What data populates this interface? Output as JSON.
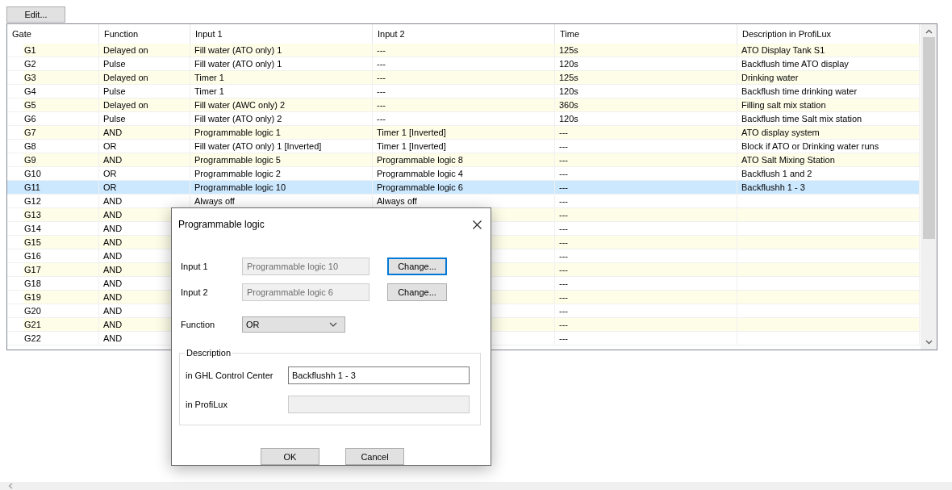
{
  "toolbar": {
    "edit_button": "Edit..."
  },
  "table": {
    "columns": [
      "Gate",
      "Function",
      "Input 1",
      "Input 2",
      "Time",
      "Description in ProfiLux"
    ],
    "rows": [
      {
        "gate": "G1",
        "function": "Delayed on",
        "input_1": "Fill water (ATO only) 1",
        "input_2": "---",
        "time": "125s",
        "description": "ATO Display Tank S1",
        "selected": false
      },
      {
        "gate": "G2",
        "function": "Pulse",
        "input_1": "Fill water (ATO only) 1",
        "input_2": "---",
        "time": "120s",
        "description": "Backflush time ATO display",
        "selected": false
      },
      {
        "gate": "G3",
        "function": "Delayed on",
        "input_1": "Timer 1",
        "input_2": "---",
        "time": "125s",
        "description": "Drinking water",
        "selected": false
      },
      {
        "gate": "G4",
        "function": "Pulse",
        "input_1": "Timer 1",
        "input_2": "---",
        "time": "120s",
        "description": "Backflush time drinking water",
        "selected": false
      },
      {
        "gate": "G5",
        "function": "Delayed on",
        "input_1": "Fill water (AWC only) 2",
        "input_2": "---",
        "time": "360s",
        "description": "Filling salt mix station",
        "selected": false
      },
      {
        "gate": "G6",
        "function": "Pulse",
        "input_1": "Fill water (ATO only) 2",
        "input_2": "---",
        "time": "120s",
        "description": "Backflush time Salt mix station",
        "selected": false
      },
      {
        "gate": "G7",
        "function": "AND",
        "input_1": "Programmable logic 1",
        "input_2": "Timer 1 [Inverted]",
        "time": "---",
        "description": "ATO display system",
        "selected": false
      },
      {
        "gate": "G8",
        "function": "OR",
        "input_1": "Fill water (ATO only) 1 [Inverted]",
        "input_2": "Timer 1 [Inverted]",
        "time": "---",
        "description": "Block if ATO or Drinking water runs",
        "selected": false
      },
      {
        "gate": "G9",
        "function": "AND",
        "input_1": "Programmable logic 5",
        "input_2": "Programmable logic 8",
        "time": "---",
        "description": "ATO Salt Mixing Station",
        "selected": false
      },
      {
        "gate": "G10",
        "function": "OR",
        "input_1": "Programmable logic 2",
        "input_2": "Programmable logic 4",
        "time": "---",
        "description": "Backflush 1 and 2",
        "selected": false
      },
      {
        "gate": "G11",
        "function": "OR",
        "input_1": "Programmable logic 10",
        "input_2": "Programmable logic 6",
        "time": "---",
        "description": "Backflushh 1 - 3",
        "selected": true
      },
      {
        "gate": "G12",
        "function": "AND",
        "input_1": "Always off",
        "input_2": "Always off",
        "time": "---",
        "selected": false
      },
      {
        "gate": "G13",
        "function": "AND",
        "time": "---",
        "selected": false
      },
      {
        "gate": "G14",
        "function": "AND",
        "time": "---",
        "selected": false
      },
      {
        "gate": "G15",
        "function": "AND",
        "time": "---",
        "selected": false
      },
      {
        "gate": "G16",
        "function": "AND",
        "time": "---",
        "selected": false
      },
      {
        "gate": "G17",
        "function": "AND",
        "time": "---",
        "selected": false
      },
      {
        "gate": "G18",
        "function": "AND",
        "time": "---",
        "selected": false
      },
      {
        "gate": "G19",
        "function": "AND",
        "time": "---",
        "selected": false
      },
      {
        "gate": "G20",
        "function": "AND",
        "time": "---",
        "selected": false
      },
      {
        "gate": "G21",
        "function": "AND",
        "time": "---",
        "selected": false
      },
      {
        "gate": "G22",
        "function": "AND",
        "time": "---",
        "selected": false
      }
    ]
  },
  "dialog": {
    "title": "Programmable logic",
    "input_1": {
      "label": "Input 1",
      "value": "Programmable logic 10",
      "button": "Change...",
      "focused": true
    },
    "input_2": {
      "label": "Input 2",
      "value": "Programmable logic 6",
      "button": "Change...",
      "focused": false
    },
    "function": {
      "label": "Function",
      "value": "OR"
    },
    "description": {
      "legend": "Description",
      "ghl_label": "in GHL Control Center",
      "ghl_value": "Backflushh 1 - 3",
      "profilux_label": "in ProfiLux"
    },
    "ok_button": "OK",
    "cancel_button": "Cancel"
  }
}
